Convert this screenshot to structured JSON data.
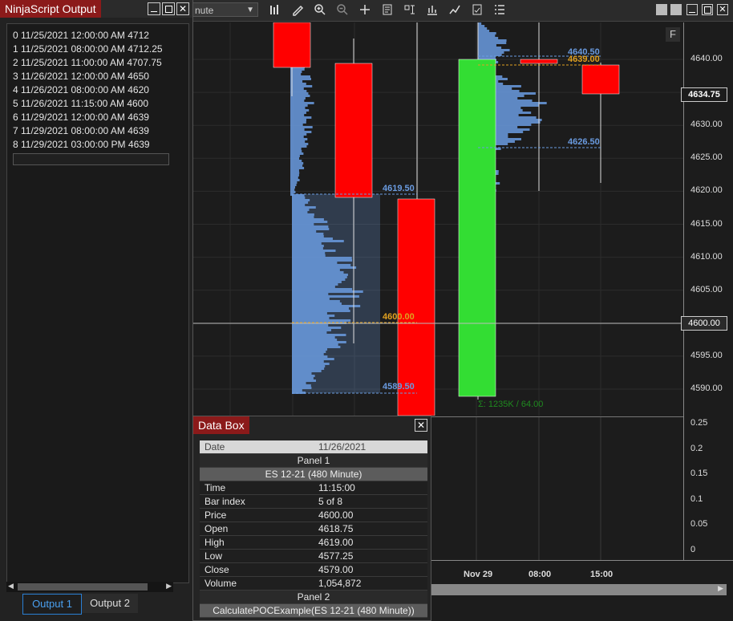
{
  "output": {
    "title": "NinjaScript Output",
    "lines": [
      "0 11/25/2021 12:00:00 AM 4712",
      "1 11/25/2021 08:00:00 AM 4712.25",
      "2 11/25/2021 11:00:00 AM 4707.75",
      "3 11/26/2021 12:00:00 AM 4650",
      "4 11/26/2021 08:00:00 AM 4620",
      "5 11/26/2021 11:15:00 AM 4600",
      "6 11/29/2021 12:00:00 AM 4639",
      "7 11/29/2021 08:00:00 AM 4639",
      "8 11/29/2021 03:00:00 PM 4639"
    ],
    "tabs": [
      "Output 1",
      "Output 2"
    ],
    "active_tab": "Output 1"
  },
  "chart": {
    "interval": "nute",
    "toolbar_icons": [
      "bars-icon",
      "pencil-icon",
      "zoom-in-icon",
      "zoom-out-icon",
      "crosshair-icon",
      "properties-icon",
      "strategy-icon",
      "indicators-icon",
      "line-icon",
      "templates-icon",
      "list-icon"
    ],
    "price_ticks": [
      "4640.00",
      "4635.00",
      "4630.00",
      "4625.00",
      "4620.00",
      "4615.00",
      "4610.00",
      "4605.00",
      "4600.00",
      "4595.00",
      "4590.00"
    ],
    "last_price": "4634.75",
    "crosshair_price": "4600.00",
    "lower_ticks": [
      "0.25",
      "0.2",
      "0.15",
      "0.1",
      "0.05",
      "0"
    ],
    "time_labels": [
      "Nov 29",
      "08:00",
      "15:00"
    ],
    "f_label": "F",
    "levels": {
      "l4640": "4640.50",
      "l4639": "4639.00",
      "l4626": "4626.50",
      "l4619": "4619.50",
      "l4600": "4600.00",
      "l4589": "4589.50"
    },
    "volume_note": "Σ: 1235K / 64.00",
    "colors": {
      "up": "#33dd33",
      "down": "#ff0000",
      "profile": "#6a9be0",
      "poc": "#e0a020"
    }
  },
  "databox": {
    "title": "Data Box",
    "date_label": "Date",
    "date_value": "11/26/2021",
    "panel1": "Panel 1",
    "instrument": "ES 12-21 (480 Minute)",
    "rows": [
      {
        "k": "Time",
        "v": "11:15:00"
      },
      {
        "k": "Bar index",
        "v": "5 of 8"
      },
      {
        "k": "Price",
        "v": "4600.00"
      },
      {
        "k": "Open",
        "v": "4618.75"
      },
      {
        "k": "High",
        "v": "4619.00"
      },
      {
        "k": "Low",
        "v": "4577.25"
      },
      {
        "k": "Close",
        "v": "4579.00"
      },
      {
        "k": "Volume",
        "v": "1,054,872"
      }
    ],
    "panel2": "Panel 2",
    "indicator": "CalculatePOCExample(ES 12-21 (480 Minute))"
  }
}
